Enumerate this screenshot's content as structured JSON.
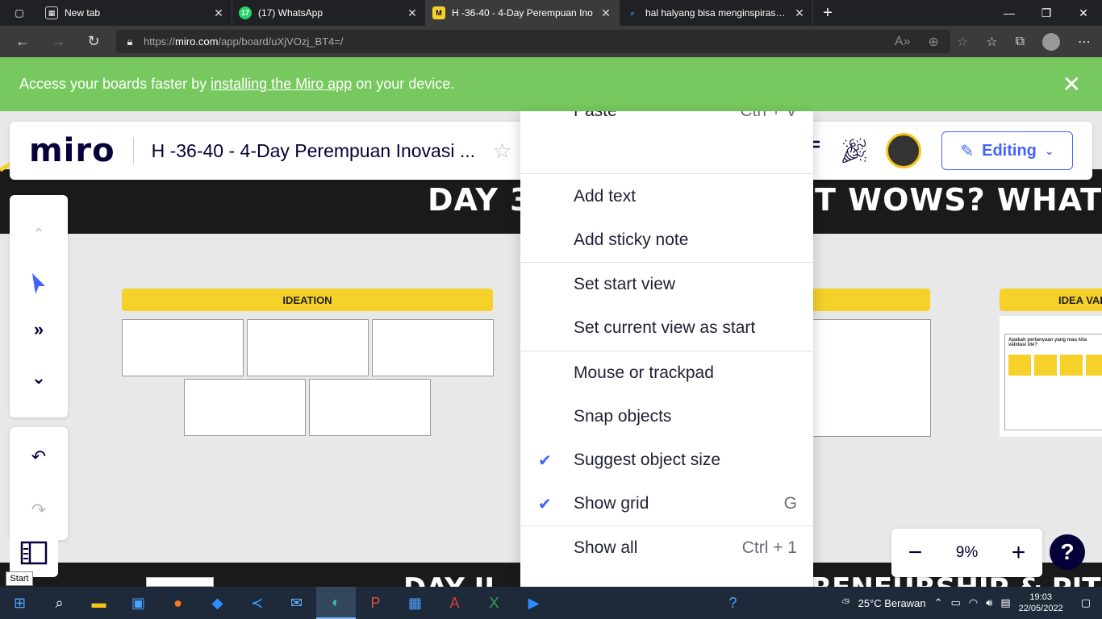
{
  "browser": {
    "tabs": [
      {
        "title": "New tab",
        "icon": "newtab-icon"
      },
      {
        "title": "(17) WhatsApp",
        "icon": "whatsapp-icon",
        "badge": "17"
      },
      {
        "title": "H -36-40 - 4-Day Perempuan Ino",
        "icon": "miro-icon",
        "active": true
      },
      {
        "title": "hal halyang bisa menginspirasi fo",
        "icon": "search-icon"
      }
    ],
    "url_prefix": "https://",
    "url_host": "miro.com",
    "url_path": "/app/board/uXjVOzj_BT4=/"
  },
  "banner": {
    "text_before": "Access your boards faster by",
    "link": "installing the Miro app",
    "text_after": "on your device."
  },
  "miro": {
    "logo": "miro",
    "board_title": "H -36-40 - 4-Day Perempuan Inovasi ...",
    "editing_label": "Editing",
    "zoom": "9%",
    "start_tooltip": "Start"
  },
  "board": {
    "day_heading_left": "DAY 3",
    "day_heading_right": "T WOWS? WHAT W",
    "day_footer_left": "DAY II",
    "day_footer_right": "RENEURSHIP & PIT",
    "ideation_label": "IDEATION",
    "idea_val_label": "IDEA VAL",
    "idea_val_note": "Apakah pertanyaan yang mau kita validasi ide?"
  },
  "menu": {
    "paste": "Paste",
    "paste_shortcut": "Ctrl + V",
    "items": [
      {
        "label": "Add text",
        "checked": false,
        "shortcut": ""
      },
      {
        "label": "Add sticky note",
        "checked": false,
        "shortcut": ""
      },
      {
        "label": "Set start view",
        "checked": false,
        "shortcut": ""
      },
      {
        "label": "Set current view as start",
        "checked": false,
        "shortcut": ""
      },
      {
        "label": "Mouse or trackpad",
        "checked": false,
        "shortcut": ""
      },
      {
        "label": "Snap objects",
        "checked": false,
        "shortcut": ""
      },
      {
        "label": "Suggest object size",
        "checked": true,
        "shortcut": ""
      },
      {
        "label": "Show grid",
        "checked": true,
        "shortcut": "G"
      },
      {
        "label": "Show all",
        "checked": false,
        "shortcut": "Ctrl + 1"
      }
    ]
  },
  "taskbar": {
    "weather": "25°C  Berawan",
    "time": "19:03",
    "date": "22/05/2022"
  },
  "colors": {
    "banner": "#77c95f",
    "accent": "#4262ff",
    "sticky": "#f5d12a",
    "miro_dark": "#050038"
  }
}
